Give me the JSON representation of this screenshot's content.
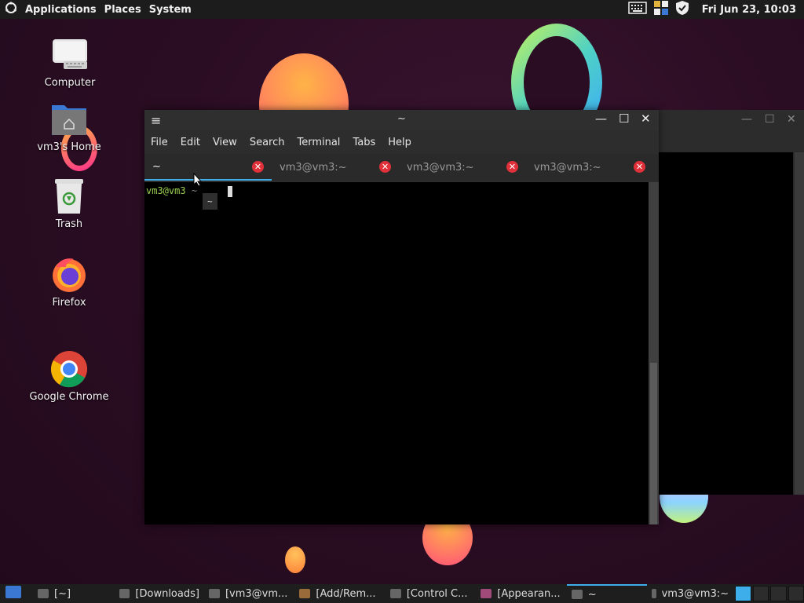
{
  "top_panel": {
    "menus": [
      "Applications",
      "Places",
      "System"
    ],
    "clock": "Fri Jun 23, 10:03"
  },
  "desktop_icons": [
    {
      "label": "Computer"
    },
    {
      "label": "vm3's Home"
    },
    {
      "label": "Trash"
    },
    {
      "label": "Firefox"
    },
    {
      "label": "Google Chrome"
    }
  ],
  "terminal": {
    "title": "~",
    "menu": [
      "File",
      "Edit",
      "View",
      "Search",
      "Terminal",
      "Tabs",
      "Help"
    ],
    "tabs": [
      "~",
      "vm3@vm3:~",
      "vm3@vm3:~",
      "vm3@vm3:~"
    ],
    "prompt_user": "vm3@vm3",
    "prompt_path": "~",
    "tooltip": "~"
  },
  "taskbar": {
    "tasks": [
      "[~]",
      "[Downloads]",
      "[vm3@vm...",
      "[Add/Rem...",
      "[Control C...",
      "[Appearan...",
      "~",
      "vm3@vm3:~"
    ]
  },
  "colors": {
    "accent": "#3daee9",
    "tab_close": "#e0303a",
    "prompt_user": "#9ad04f"
  }
}
